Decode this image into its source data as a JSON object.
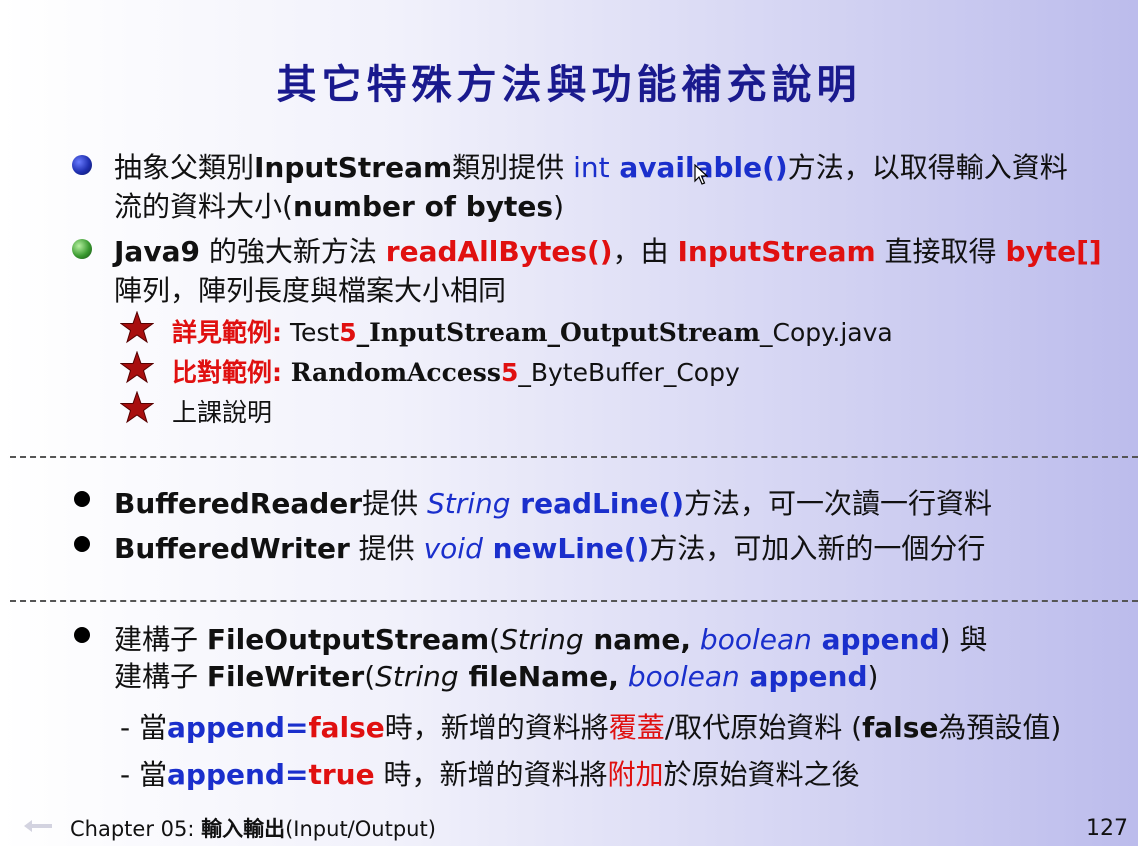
{
  "title": "其它特殊方法與功能補充說明",
  "sec1": {
    "b1_l1": {
      "p1": "抽象父類別",
      "p2": "InputStream",
      "p3": "類別提供 ",
      "p4": "int",
      "p5": " available()",
      "p6": "方法，以取得輸入資料"
    },
    "b1_l2": {
      "p1": "流的資料大小(",
      "p2": "number of bytes",
      "p3": ")"
    },
    "b2_l1": {
      "p1": "Java9",
      "p2": " 的強大新方法 ",
      "p3": "readAllBytes()",
      "p4": "，由 ",
      "p5": "InputStream",
      "p6": " 直接取得 ",
      "p7": "byte[]"
    },
    "b2_l2": "陣列，陣列長度與檔案大小相同",
    "s1": {
      "label": "詳見範例:",
      "t1": " Test",
      "t2": "5",
      "t3": "_InputStream_OutputStream",
      "t4": "_Copy.java"
    },
    "s2": {
      "label": "比對範例:",
      "t1": " RandomAccess",
      "t2": "5",
      "t3": "_ByteBuffer_Copy"
    },
    "s3": "上課說明"
  },
  "sec2": {
    "l1": {
      "p1": "BufferedReader",
      "p2": "提供 ",
      "p3": "String",
      "p4": " readLine()",
      "p5": "方法，可一次讀一行資料"
    },
    "l2": {
      "p1": "BufferedWriter",
      "p2": "  提供 ",
      "p3": "void",
      "p4": " newLine()",
      "p5": "方法，可加入新的一個分行"
    }
  },
  "sec3": {
    "l1": {
      "p1": "建構子 ",
      "p2": "FileOutputStream",
      "p3": "(",
      "p4": "String",
      "p5": " name,",
      "p6": " boolean",
      "p7": " append",
      "p8": ") 與"
    },
    "l2": {
      "p1": "建構子 ",
      "p2": "FileWriter",
      "p3": "(",
      "p4": "String",
      "p5": " fileName,",
      "p6": " boolean",
      "p7": " append",
      "p8": ")"
    },
    "d1": {
      "p1": "- 當",
      "p2": "append=",
      "p3": "false",
      "p4": "時，新增的資料將",
      "p5": "覆蓋",
      "p6": "/取代原始資料 (",
      "p7": "false",
      "p8": "為預設值)"
    },
    "d2": {
      "p1": "- 當",
      "p2": "append=",
      "p3": "true",
      "p4": " 時，新增的資料將",
      "p5": "附加",
      "p6": "於原始資料之後"
    }
  },
  "footer": {
    "chapter": "Chapter 05:  ",
    "chapter_name": "輸入輸出",
    "chapter_sub": "(Input/Output)",
    "page": "127"
  }
}
